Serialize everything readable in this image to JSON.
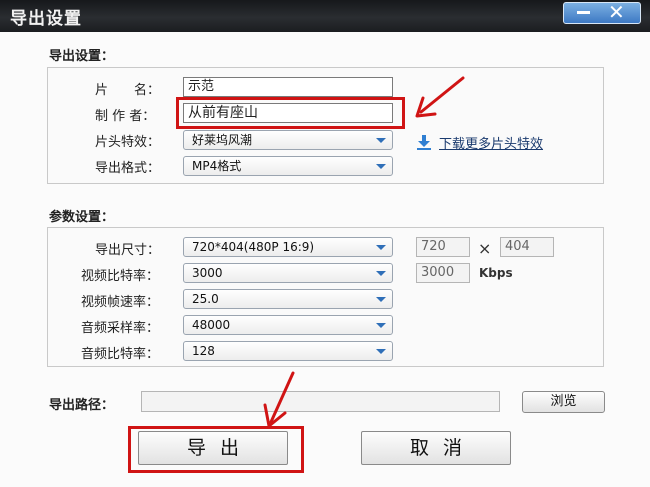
{
  "window": {
    "title": "导出设置"
  },
  "export_settings": {
    "section_title": "导出设置：",
    "name_label": "片　　名：",
    "name_value": "示范",
    "author_label": "制 作 者：",
    "author_value": "从前有座山",
    "intro_effect_label": "片头特效：",
    "intro_effect_value": "好莱坞风潮",
    "download_link": "下载更多片头特效",
    "format_label": "导出格式：",
    "format_value": "MP4格式"
  },
  "params": {
    "section_title": "参数设置：",
    "size_label": "导出尺寸：",
    "size_value": "720*404(480P 16:9)",
    "width_value": "720",
    "height_value": "404",
    "vbitrate_label": "视频比特率：",
    "vbitrate_value": "3000",
    "vbitrate_box": "3000",
    "vbitrate_unit": "Kbps",
    "framerate_label": "视频帧速率：",
    "framerate_value": "25.0",
    "samplerate_label": "音频采样率：",
    "samplerate_value": "48000",
    "abitrate_label": "音频比特率：",
    "abitrate_value": "128"
  },
  "output": {
    "path_label": "导出路径：",
    "path_value": "",
    "browse_label": "浏览"
  },
  "buttons": {
    "export_label": "导出",
    "cancel_label": "取消"
  },
  "colors": {
    "highlight": "#d01414",
    "titlebar": "#1e2023",
    "link": "#1a3a6e",
    "dropdown_arrow": "#2f6fb8"
  }
}
